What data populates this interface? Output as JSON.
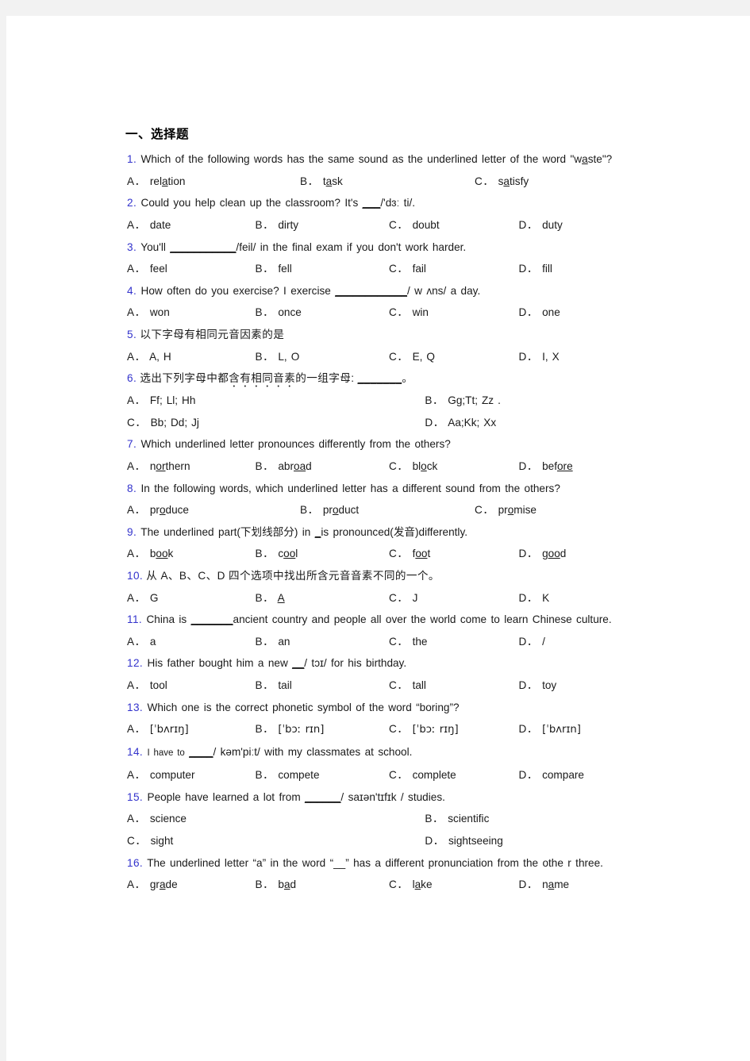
{
  "document": {
    "section_heading": "一、选择题",
    "questions": [
      {
        "num": "1.",
        "stem_pre": "Which of the following words has the same sound as the underlined letter of the word \"w",
        "stem_underline": "a",
        "stem_post": "ste\"?",
        "layout": "c3",
        "options": [
          {
            "label": "A．",
            "pre": "rel",
            "u": "a",
            "post": "tion"
          },
          {
            "label": "B．",
            "pre": "t",
            "u": "a",
            "post": "sk"
          },
          {
            "label": "C．",
            "pre": "s",
            "u": "a",
            "post": "tisfy"
          }
        ]
      },
      {
        "num": "2.",
        "stem_pre": "Could you help clean up the classroom? It's",
        "stem_blank": "___",
        "stem_post": "/'dɜː ti/.",
        "layout": "c4",
        "options": [
          {
            "label": "A．",
            "pre": "date",
            "u": "",
            "post": ""
          },
          {
            "label": "B．",
            "pre": "dirty",
            "u": "",
            "post": ""
          },
          {
            "label": "C．",
            "pre": "doubt",
            "u": "",
            "post": ""
          },
          {
            "label": "D．",
            "pre": "duty",
            "u": "",
            "post": ""
          }
        ]
      },
      {
        "num": "3.",
        "stem_pre": "You'll",
        "stem_blank": "___________",
        "stem_post": "/feil/ in the final exam if you don't work harder.",
        "layout": "c4",
        "options": [
          {
            "label": "A．",
            "pre": "feel",
            "u": "",
            "post": ""
          },
          {
            "label": "B．",
            "pre": "fell",
            "u": "",
            "post": ""
          },
          {
            "label": "C．",
            "pre": "fail",
            "u": "",
            "post": ""
          },
          {
            "label": "D．",
            "pre": "fill",
            "u": "",
            "post": ""
          }
        ]
      },
      {
        "num": "4.",
        "stem_pre": "How often do you exercise? I exercise",
        "stem_blank": "____________",
        "stem_post": "/ w ʌns/ a day.",
        "layout": "c4",
        "options": [
          {
            "label": "A．",
            "pre": "won",
            "u": "",
            "post": ""
          },
          {
            "label": "B．",
            "pre": "once",
            "u": "",
            "post": ""
          },
          {
            "label": "C．",
            "pre": "win",
            "u": "",
            "post": ""
          },
          {
            "label": "D．",
            "pre": "one",
            "u": "",
            "post": ""
          }
        ]
      },
      {
        "num": "5.",
        "stem_pre": "以下字母有相同元音因素的是",
        "stem_blank": "",
        "stem_post": "",
        "chinese": true,
        "layout": "c4",
        "options": [
          {
            "label": "A．",
            "pre": "A, H",
            "u": "",
            "post": ""
          },
          {
            "label": "B．",
            "pre": "L, O",
            "u": "",
            "post": ""
          },
          {
            "label": "C．",
            "pre": "E, Q",
            "u": "",
            "post": ""
          },
          {
            "label": "D．",
            "pre": "I, X",
            "u": "",
            "post": ""
          }
        ]
      },
      {
        "num": "6.",
        "stem_pre": "选出下列字母中都",
        "stem_dotted": "含有相同音素",
        "stem_mid": "的一组字母:",
        "stem_blank": "_______",
        "stem_post": "。",
        "chinese": true,
        "layout": "grid2x2",
        "options": [
          {
            "label": "A．",
            "pre": "Ff; Ll; Hh",
            "u": "",
            "post": ""
          },
          {
            "label": "B．",
            "pre": "Gg;Tt; Zz .",
            "u": "",
            "post": ""
          },
          {
            "label": "C．",
            "pre": "Bb; Dd; Jj",
            "u": "",
            "post": ""
          },
          {
            "label": "D．",
            "pre": "Aa;Kk; Xx",
            "u": "",
            "post": ""
          }
        ]
      },
      {
        "num": "7.",
        "stem_pre": "Which underlined letter pronounces differently from the others?",
        "stem_blank": "",
        "stem_post": "",
        "layout": "c4",
        "options": [
          {
            "label": "A．",
            "pre": "n",
            "u": "or",
            "post": "thern"
          },
          {
            "label": "B．",
            "pre": "abr",
            "u": "oa",
            "post": "d"
          },
          {
            "label": "C．",
            "pre": "bl",
            "u": "o",
            "post": "ck"
          },
          {
            "label": "D．",
            "pre": "bef",
            "u": "ore",
            "post": ""
          }
        ]
      },
      {
        "num": "8.",
        "stem_pre": "In the following words, which underlined letter has a different sound from the others?",
        "stem_blank": "",
        "stem_post": "",
        "layout": "c3",
        "options": [
          {
            "label": "A．",
            "pre": "pr",
            "u": "o",
            "post": "duce"
          },
          {
            "label": "B．",
            "pre": "pr",
            "u": "o",
            "post": "duct"
          },
          {
            "label": "C．",
            "pre": "pr",
            "u": "o",
            "post": "mise"
          }
        ]
      },
      {
        "num": "9.",
        "stem_pre": "The underlined part(下划线部分) in",
        "stem_blank": "_",
        "stem_post": "is pronounced(发音)differently.",
        "layout": "c4",
        "options": [
          {
            "label": "A．",
            "pre": "b",
            "u": "oo",
            "post": "k"
          },
          {
            "label": "B．",
            "pre": "c",
            "u": "oo",
            "post": "l"
          },
          {
            "label": "C．",
            "pre": "f",
            "u": "oo",
            "post": "t"
          },
          {
            "label": "D．",
            "pre": "g",
            "u": "oo",
            "post": "d"
          }
        ]
      },
      {
        "num": "10.",
        "stem_pre": "从 A、B、C、D 四个选项中找出所含元音音素不同的一个。",
        "stem_blank": "",
        "stem_post": "",
        "chinese": true,
        "layout": "c4",
        "options": [
          {
            "label": "A．",
            "pre": "G",
            "u": "",
            "post": ""
          },
          {
            "label": "B．",
            "pre": "",
            "u": "A",
            "post": ""
          },
          {
            "label": "C．",
            "pre": "J",
            "u": "",
            "post": ""
          },
          {
            "label": "D．",
            "pre": "K",
            "u": "",
            "post": ""
          }
        ]
      },
      {
        "num": "11.",
        "stem_pre": "China is",
        "stem_blank": "_______",
        "stem_post": "ancient country and people all over the world come to learn Chinese culture.",
        "layout": "c4",
        "options": [
          {
            "label": "A．",
            "pre": "a",
            "u": "",
            "post": ""
          },
          {
            "label": "B．",
            "pre": "an",
            "u": "",
            "post": ""
          },
          {
            "label": "C．",
            "pre": "the",
            "u": "",
            "post": ""
          },
          {
            "label": "D．",
            "pre": "/",
            "u": "",
            "post": ""
          }
        ]
      },
      {
        "num": "12.",
        "stem_pre": "His father bought him a new",
        "stem_blank": "__",
        "stem_post": "/ tɔɪ/ for his birthday.",
        "layout": "c4",
        "options": [
          {
            "label": "A．",
            "pre": "tool",
            "u": "",
            "post": ""
          },
          {
            "label": "B．",
            "pre": "tail",
            "u": "",
            "post": ""
          },
          {
            "label": "C．",
            "pre": "tall",
            "u": "",
            "post": ""
          },
          {
            "label": "D．",
            "pre": "toy",
            "u": "",
            "post": ""
          }
        ]
      },
      {
        "num": "13.",
        "stem_pre": "Which one is the correct phonetic symbol of the word “boring”?",
        "stem_blank": "",
        "stem_post": "",
        "layout": "c4",
        "options": [
          {
            "label": "A．",
            "pre": "[ˈbʌrɪŋ]",
            "u": "",
            "post": ""
          },
          {
            "label": "B．",
            "pre": "[ˈbɔː rɪn]",
            "u": "",
            "post": ""
          },
          {
            "label": "C．",
            "pre": "[ˈbɔː rɪŋ]",
            "u": "",
            "post": ""
          },
          {
            "label": "D．",
            "pre": "[ˈbʌrɪn]",
            "u": "",
            "post": ""
          }
        ]
      },
      {
        "num": "14.",
        "stem_pre": "I have to",
        "stem_blank": "____",
        "stem_post": "/ kəm'piːt/ with my classmates at school.",
        "small_stem": true,
        "layout": "c4",
        "options": [
          {
            "label": "A．",
            "pre": "computer",
            "u": "",
            "post": ""
          },
          {
            "label": "B．",
            "pre": "compete",
            "u": "",
            "post": ""
          },
          {
            "label": "C．",
            "pre": "complete",
            "u": "",
            "post": ""
          },
          {
            "label": "D．",
            "pre": "compare",
            "u": "",
            "post": ""
          }
        ]
      },
      {
        "num": "15.",
        "stem_pre": "People have learned a lot from",
        "stem_blank": "______",
        "stem_post": "/ saɪən'tɪfɪk / studies.",
        "layout": "grid2x2",
        "options": [
          {
            "label": "A．",
            "pre": "science",
            "u": "",
            "post": ""
          },
          {
            "label": "B．",
            "pre": "scientific",
            "u": "",
            "post": ""
          },
          {
            "label": "C．",
            "pre": "sight",
            "u": "",
            "post": ""
          },
          {
            "label": "D．",
            "pre": "sightseeing",
            "u": "",
            "post": ""
          }
        ]
      },
      {
        "num": "16.",
        "stem_pre": "The underlined letter “a” in the word “__” has a different pronunciation from the othe r three.",
        "stem_blank": "",
        "stem_post": "",
        "layout": "c4",
        "options": [
          {
            "label": "A．",
            "pre": "gr",
            "u": "a",
            "post": "de"
          },
          {
            "label": "B．",
            "pre": "b",
            "u": "a",
            "post": "d"
          },
          {
            "label": "C．",
            "pre": "l",
            "u": "a",
            "post": "ke"
          },
          {
            "label": "D．",
            "pre": "n",
            "u": "a",
            "post": "me"
          }
        ]
      }
    ]
  },
  "colors": {
    "question_number": "#3333cc",
    "text": "#1a1a1a",
    "page_background": "#ffffff",
    "canvas_background": "#f2f2f2"
  }
}
